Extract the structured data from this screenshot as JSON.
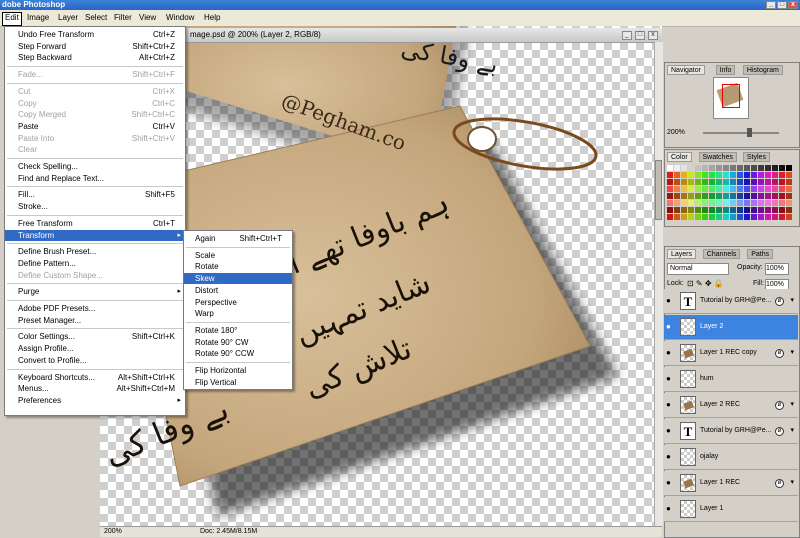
{
  "app": {
    "title": "dobe Photoshop"
  },
  "menubar": [
    "Edit",
    "Image",
    "Layer",
    "Select",
    "Filter",
    "View",
    "Window",
    "Help"
  ],
  "document": {
    "title": "mage.psd @ 200% (Layer 2, RGB/8)",
    "status_zoom": "200%",
    "status_doc": "Doc: 2.45M/8.15M"
  },
  "card_text": {
    "email": "@Pegham.co",
    "line1": "ہم باوفا تھے اس",
    "line2": "شاید تمہیں",
    "line3": "تلاش کی",
    "line4": "بے وفا کی"
  },
  "edit_menu": [
    {
      "label": "Undo Free Transform",
      "shortcut": "Ctrl+Z",
      "disabled": false
    },
    {
      "label": "Step Forward",
      "shortcut": "Shift+Ctrl+Z",
      "disabled": false
    },
    {
      "label": "Step Backward",
      "shortcut": "Alt+Ctrl+Z",
      "disabled": false
    },
    {
      "sep": true
    },
    {
      "label": "Fade...",
      "shortcut": "Shift+Ctrl+F",
      "disabled": true
    },
    {
      "sep": true
    },
    {
      "label": "Cut",
      "shortcut": "Ctrl+X",
      "disabled": true
    },
    {
      "label": "Copy",
      "shortcut": "Ctrl+C",
      "disabled": true
    },
    {
      "label": "Copy Merged",
      "shortcut": "Shift+Ctrl+C",
      "disabled": true
    },
    {
      "label": "Paste",
      "shortcut": "Ctrl+V",
      "disabled": false
    },
    {
      "label": "Paste Into",
      "shortcut": "Shift+Ctrl+V",
      "disabled": true
    },
    {
      "label": "Clear",
      "shortcut": "",
      "disabled": true
    },
    {
      "sep": true
    },
    {
      "label": "Check Spelling...",
      "shortcut": "",
      "disabled": false
    },
    {
      "label": "Find and Replace Text...",
      "shortcut": "",
      "disabled": false
    },
    {
      "sep": true
    },
    {
      "label": "Fill...",
      "shortcut": "Shift+F5",
      "disabled": false
    },
    {
      "label": "Stroke...",
      "shortcut": "",
      "disabled": false
    },
    {
      "sep": true
    },
    {
      "label": "Free Transform",
      "shortcut": "Ctrl+T",
      "disabled": false
    },
    {
      "label": "Transform",
      "shortcut": "",
      "disabled": false,
      "highlight": true,
      "submenu": true
    },
    {
      "sep": true
    },
    {
      "label": "Define Brush Preset...",
      "shortcut": "",
      "disabled": false
    },
    {
      "label": "Define Pattern...",
      "shortcut": "",
      "disabled": false
    },
    {
      "label": "Define Custom Shape...",
      "shortcut": "",
      "disabled": true
    },
    {
      "sep": true
    },
    {
      "label": "Purge",
      "shortcut": "",
      "disabled": false,
      "submenu": true
    },
    {
      "sep": true
    },
    {
      "label": "Adobe PDF Presets...",
      "shortcut": "",
      "disabled": false
    },
    {
      "label": "Preset Manager...",
      "shortcut": "",
      "disabled": false
    },
    {
      "sep": true
    },
    {
      "label": "Color Settings...",
      "shortcut": "Shift+Ctrl+K",
      "disabled": false
    },
    {
      "label": "Assign Profile...",
      "shortcut": "",
      "disabled": false
    },
    {
      "label": "Convert to Profile...",
      "shortcut": "",
      "disabled": false
    },
    {
      "sep": true
    },
    {
      "label": "Keyboard Shortcuts...",
      "shortcut": "Alt+Shift+Ctrl+K",
      "disabled": false
    },
    {
      "label": "Menus...",
      "shortcut": "Alt+Shift+Ctrl+M",
      "disabled": false
    },
    {
      "label": "Preferences",
      "shortcut": "",
      "disabled": false,
      "submenu": true
    }
  ],
  "transform_menu": [
    {
      "label": "Again",
      "shortcut": "Shift+Ctrl+T"
    },
    {
      "sep": true
    },
    {
      "label": "Scale"
    },
    {
      "label": "Rotate"
    },
    {
      "label": "Skew",
      "highlight": true
    },
    {
      "label": "Distort"
    },
    {
      "label": "Perspective"
    },
    {
      "label": "Warp"
    },
    {
      "sep": true
    },
    {
      "label": "Rotate 180°"
    },
    {
      "label": "Rotate 90° CW"
    },
    {
      "label": "Rotate 90° CCW"
    },
    {
      "sep": true
    },
    {
      "label": "Flip Horizontal"
    },
    {
      "label": "Flip Vertical"
    }
  ],
  "navigator": {
    "tabs": [
      "Navigator",
      "Info",
      "Histogram"
    ],
    "zoom": "200%"
  },
  "swatches": {
    "tabs": [
      "Color",
      "Swatches",
      "Styles"
    ]
  },
  "layers_panel": {
    "tabs": [
      "Layers",
      "Channels",
      "Paths"
    ],
    "blend_mode": "Normal",
    "opacity_label": "Opacity:",
    "opacity": "100%",
    "lock_label": "Lock:",
    "fill_label": "Fill:",
    "fill": "100%",
    "layers": [
      {
        "name": "Tutorial by GRH@Pe...",
        "type": "text",
        "fx": true,
        "selected": false
      },
      {
        "name": "Layer 2",
        "type": "empty",
        "fx": false,
        "selected": true
      },
      {
        "name": "Layer 1 REC copy",
        "type": "image",
        "fx": true,
        "selected": false
      },
      {
        "name": "hum",
        "type": "empty",
        "fx": false,
        "selected": false
      },
      {
        "name": "Layer 2 REC",
        "type": "image",
        "fx": true,
        "selected": false
      },
      {
        "name": "Tutorial by GRH@Pe...",
        "type": "text",
        "fx": true,
        "selected": false
      },
      {
        "name": "ojalay",
        "type": "empty",
        "fx": false,
        "selected": false
      },
      {
        "name": "Layer 1 REC",
        "type": "image",
        "fx": true,
        "selected": false
      },
      {
        "name": "Layer 1",
        "type": "empty",
        "fx": false,
        "selected": false
      }
    ]
  },
  "colors": {
    "titlebar": "#2a64c5",
    "highlight": "#316ac5",
    "layer_selected": "#3d83e0",
    "card": "#c9ae87"
  }
}
